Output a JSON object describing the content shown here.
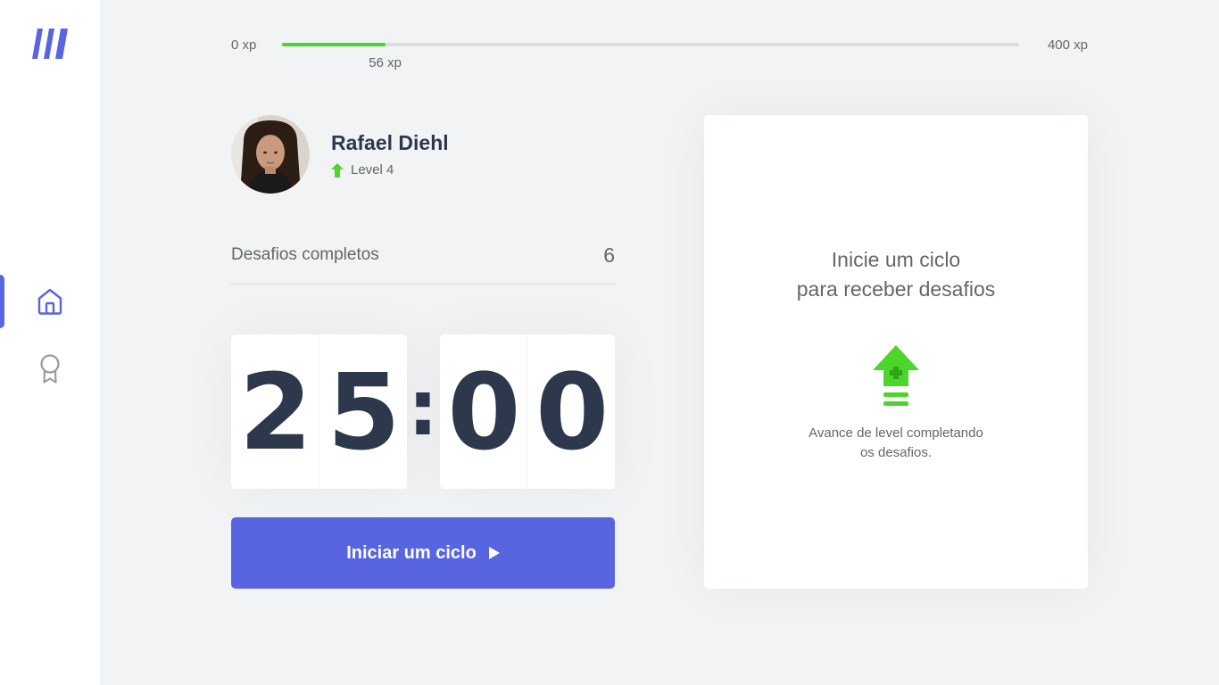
{
  "sidebar": {
    "logo_icon": "logo-icon",
    "items": [
      {
        "name": "home",
        "icon": "home-icon",
        "active": true
      },
      {
        "name": "leaderboard",
        "icon": "award-icon",
        "active": false
      }
    ],
    "accent_color": "#5965e0"
  },
  "experience": {
    "min_label": "0 xp",
    "max_label": "400 xp",
    "current_label": "56 xp",
    "current": 56,
    "max": 400,
    "fill_color": "#4cd62b"
  },
  "profile": {
    "name": "Rafael Diehl",
    "level_label": "Level 4",
    "level_icon": "level-up-arrow-icon"
  },
  "completed": {
    "label": "Desafios completos",
    "count": "6"
  },
  "countdown": {
    "minute_left": "2",
    "minute_right": "5",
    "separator": ":",
    "second_left": "0",
    "second_right": "0"
  },
  "start_button": {
    "label": "Iniciar um ciclo",
    "icon": "play-icon",
    "color": "#5965e0"
  },
  "challenge_box": {
    "title_line1": "Inicie um ciclo",
    "title_line2": "para receber desafios",
    "icon": "level-up-icon",
    "text_line1": "Avance de level completando",
    "text_line2": "os desafios."
  }
}
